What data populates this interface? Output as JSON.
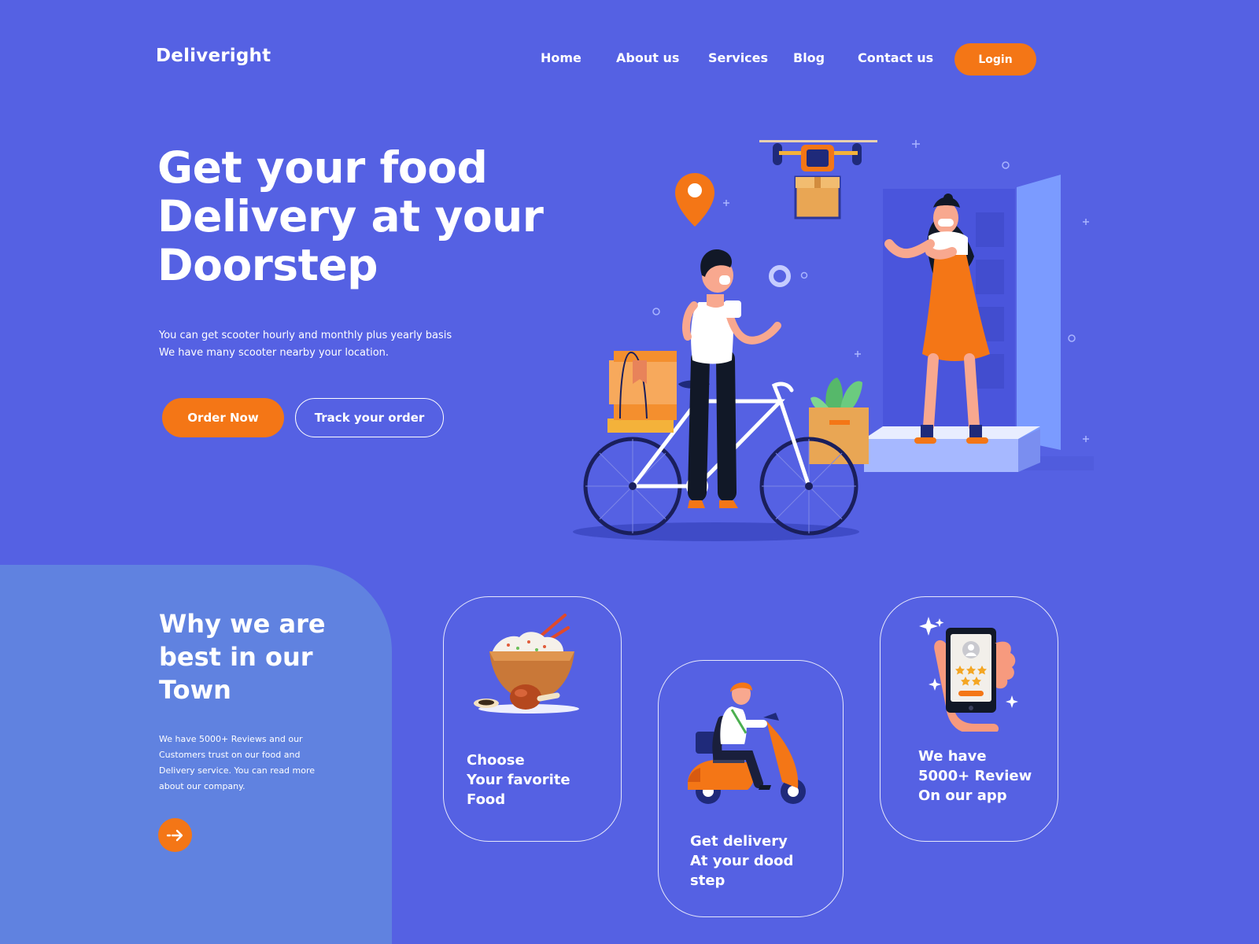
{
  "brand": {
    "name": "Deliveright"
  },
  "nav": {
    "items": [
      {
        "label": "Home"
      },
      {
        "label": "About us"
      },
      {
        "label": "Services"
      },
      {
        "label": "Blog"
      },
      {
        "label": "Contact us"
      }
    ],
    "login_label": "Login"
  },
  "hero": {
    "title_lines": [
      "Get your food",
      "Delivery at your",
      "Doorstep"
    ],
    "subtitle_lines": [
      "You can get scooter hourly and monthly plus yearly basis",
      "We have many scooter nearby your location."
    ],
    "primary_button": "Order Now",
    "secondary_button": "Track your order"
  },
  "why": {
    "title_lines": [
      "Why we are",
      "best in our",
      "Town"
    ],
    "text_lines": [
      "We have 5000+ Reviews and our",
      "Customers trust on our food and",
      "Delivery service. You can read more",
      "about our company."
    ]
  },
  "cards": [
    {
      "lines": [
        "Choose",
        "Your favorite",
        "Food"
      ],
      "icon": "rice-bowl-icon"
    },
    {
      "lines": [
        "Get delivery",
        "At your dood",
        "step"
      ],
      "icon": "scooter-rider-icon"
    },
    {
      "lines": [
        "We have",
        "5000+ Review",
        "On our app"
      ],
      "icon": "phone-review-icon"
    }
  ],
  "colors": {
    "background": "#5561E3",
    "panel": "#6082E0",
    "accent": "#F47616",
    "door": "#4A55DC",
    "door_panel": "#7B9BFF"
  }
}
